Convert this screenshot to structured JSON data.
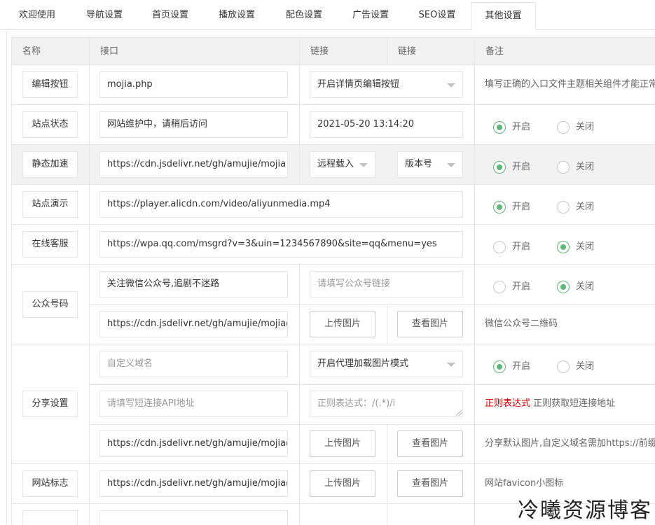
{
  "tabs": [
    {
      "label": "欢迎使用",
      "active": false
    },
    {
      "label": "导航设置",
      "active": false
    },
    {
      "label": "首页设置",
      "active": false
    },
    {
      "label": "播放设置",
      "active": false
    },
    {
      "label": "配色设置",
      "active": false
    },
    {
      "label": "广告设置",
      "active": false
    },
    {
      "label": "SEO设置",
      "active": false
    },
    {
      "label": "其他设置",
      "active": true
    }
  ],
  "table": {
    "headers": {
      "name": "名称",
      "api": "接口",
      "link1": "链接",
      "link2": "链接",
      "remark": "备注"
    },
    "radio_on": "开启",
    "radio_off": "关闭",
    "upload_label": "上传图片",
    "view_label": "查看图片",
    "rows": {
      "edit_button": {
        "name": "编辑按钮",
        "api": "mojia.php",
        "select": "开启详情页编辑按钮",
        "remark": "填写正确的入口文件主题相关组件才能正常使用"
      },
      "site_status": {
        "name": "站点状态",
        "api": "网站维护中，请稍后访问",
        "datetime": "2021-05-20 13:14:20",
        "state": "on"
      },
      "static_accel": {
        "name": "静态加速",
        "api": "https://cdn.jsdelivr.net/gh/amujie/mojia",
        "select_mode": "远程载入",
        "select_version": "版本号",
        "state": "on"
      },
      "site_demo": {
        "name": "站点演示",
        "api": "https://player.alicdn.com/video/aliyunmedia.mp4",
        "state": "on"
      },
      "online_service": {
        "name": "在线客服",
        "api": "https://wpa.qq.com/msgrd?v=3&uin=1234567890&site=qq&menu=yes",
        "state": "off"
      },
      "wechat": {
        "name": "公众号码",
        "title": "关注微信公众号,追剧不迷路",
        "link_placeholder": "请填写公众号链接",
        "state": "off",
        "image_url": "https://cdn.jsdelivr.net/gh/amujie/mojia@master/",
        "image_remark": "微信公众号二维码"
      },
      "share": {
        "name": "分享设置",
        "domain_placeholder": "自定义域名",
        "proxy_select": "开启代理加载图片模式",
        "state": "on",
        "api_placeholder": "请填写短连接API地址",
        "regex_placeholder": "正则表达式：/(.*)/i",
        "regex_remark_red": "正则表达式",
        "regex_remark": " 正则获取短连接地址",
        "image_url": "https://cdn.jsdelivr.net/gh/amujie/mojia@master/",
        "image_remark": "分享默认图片,自定义域名需加https://前缀"
      },
      "favicon": {
        "name": "网站标志",
        "image_url": "https://cdn.jsdelivr.net/gh/amujie/mojia@master/",
        "remark": "网站favicon小图标"
      }
    }
  },
  "watermark": "冷曦资源博客",
  "colors": {
    "accent": "#5fb878",
    "border": "#e6e6e6",
    "header_bg": "#f2f2f2",
    "remark_red": "#dd0000"
  }
}
